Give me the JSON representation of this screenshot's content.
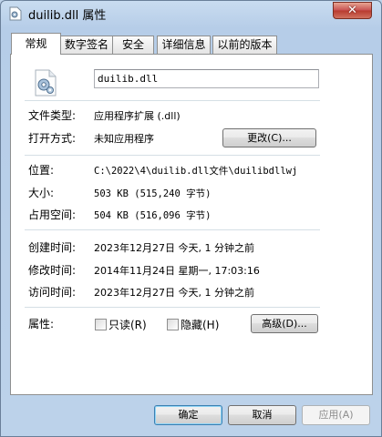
{
  "window": {
    "title": "duilib.dll 属性",
    "close_glyph": "✕"
  },
  "tabs": [
    {
      "label": "常规"
    },
    {
      "label": "数字签名"
    },
    {
      "label": "安全"
    },
    {
      "label": "详细信息"
    },
    {
      "label": "以前的版本"
    }
  ],
  "file": {
    "name": "duilib.dll"
  },
  "type_section": {
    "file_type_label": "文件类型:",
    "file_type_value": "应用程序扩展 (.dll)",
    "open_with_label": "打开方式:",
    "open_with_value": "未知应用程序",
    "change_button": "更改(C)..."
  },
  "location_section": {
    "location_label": "位置:",
    "location_value": "C:\\2022\\4\\duilib.dll文件\\duilibdllwj",
    "size_label": "大小:",
    "size_value": "503 KB (515,240 字节)",
    "disk_size_label": "占用空间:",
    "disk_size_value": "504 KB (516,096 字节)"
  },
  "time_section": {
    "created_label": "创建时间:",
    "created_value": "2023年12月27日 今天, 1 分钟之前",
    "modified_label": "修改时间:",
    "modified_value": "2014年11月24日 星期一, 17:03:16",
    "accessed_label": "访问时间:",
    "accessed_value": "2023年12月27日 今天, 1 分钟之前"
  },
  "attributes": {
    "label": "属性:",
    "readonly_label": "只读(R)",
    "readonly_checked": false,
    "hidden_label": "隐藏(H)",
    "hidden_checked": false,
    "advanced_button": "高级(D)..."
  },
  "footer": {
    "ok_button": "确定",
    "cancel_button": "取消",
    "apply_button": "应用(A)"
  }
}
